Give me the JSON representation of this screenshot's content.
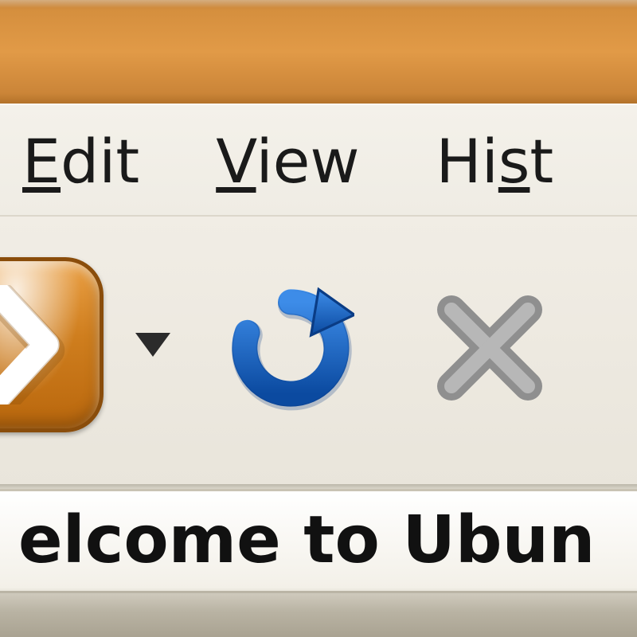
{
  "titlebar": {
    "color_top": "#d58f3e",
    "color_bottom": "#b37229"
  },
  "menubar": {
    "items": [
      {
        "label": "Edit",
        "mnemonic_index": 0
      },
      {
        "label": "View",
        "mnemonic_index": 0
      },
      {
        "label": "History",
        "mnemonic_index": 2,
        "visible_prefix": "Hist"
      }
    ]
  },
  "toolbar": {
    "forward": {
      "icon": "chevron-right",
      "color": "#ffffff"
    },
    "forward_dropdown": {
      "icon": "dropdown-arrow"
    },
    "reload": {
      "icon": "reload",
      "color": "#1b63c6"
    },
    "stop": {
      "icon": "close-x",
      "color": "#8f8f8f"
    }
  },
  "tabs": {
    "active": {
      "title_full": "Welcome to Ubuntu",
      "title_visible": "elcome to Ubun"
    }
  }
}
